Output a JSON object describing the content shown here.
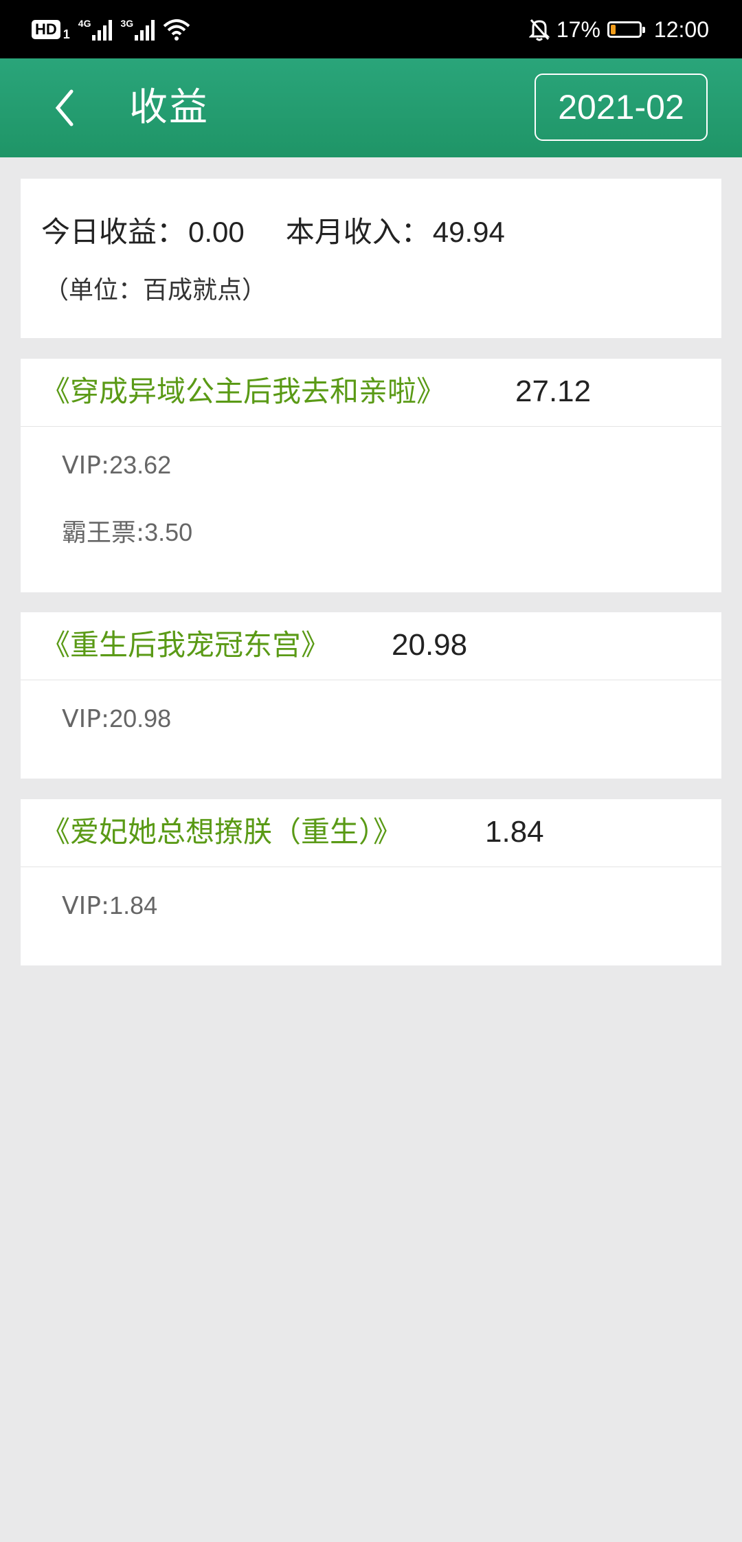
{
  "status_bar": {
    "hd": "HD",
    "sim": "1",
    "net1": "4G",
    "net2": "3G",
    "battery_pct": "17%",
    "battery_level": 0.17,
    "time": "12:00",
    "icons": [
      "signal-icon",
      "wifi-icon",
      "mute-bell-icon",
      "battery-icon"
    ]
  },
  "header": {
    "title": "收益",
    "month": "2021-02",
    "accent_color": "#2aa57a"
  },
  "summary": {
    "today_label": "今日收益：",
    "today_value": "0.00",
    "month_label": "本月收入：",
    "month_value": "49.94",
    "unit_note": "（单位：百成就点）"
  },
  "books": [
    {
      "title": "《穿成异域公主后我去和亲啦》",
      "total": "27.12",
      "lines": [
        {
          "label": "VIP:",
          "value": "23.62"
        },
        {
          "label": "霸王票:",
          "value": "3.50"
        }
      ]
    },
    {
      "title": "《重生后我宠冠东宫》",
      "total": "20.98",
      "lines": [
        {
          "label": "VIP:",
          "value": "20.98"
        }
      ]
    },
    {
      "title": "《爱妃她总想撩朕（重生）》",
      "total": "1.84",
      "lines": [
        {
          "label": "VIP:",
          "value": "1.84"
        }
      ]
    }
  ]
}
